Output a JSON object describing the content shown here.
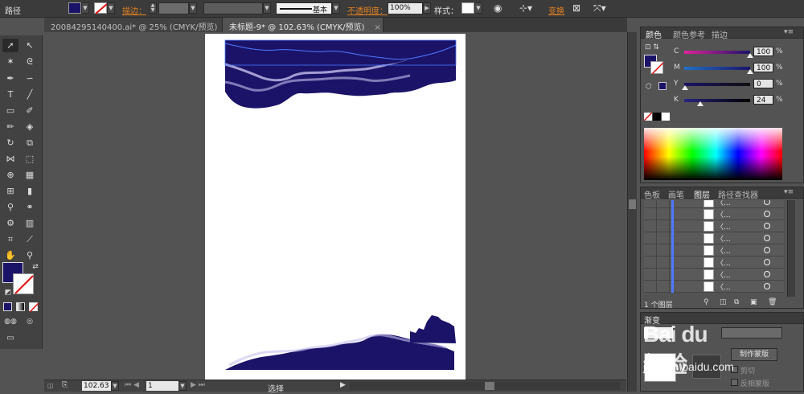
{
  "control_bar": {
    "path_label": "路径",
    "stroke_label": "描边：",
    "stroke_profile": "基本",
    "opacity_label": "不透明度：",
    "opacity_value": "100%",
    "style_label": "样式：",
    "transform_label": "变换",
    "fill_color": "#1b1368"
  },
  "tabs": [
    {
      "label": "20084295140400.ai* @ 25% (CMYK/预览)",
      "close": "×",
      "active": false
    },
    {
      "label": "未标题-9* @ 102.63% (CMYK/预览)",
      "close": "×",
      "active": true
    }
  ],
  "status_bar": {
    "zoom": "102.63",
    "page": "1",
    "selection": "选择"
  },
  "color_panel": {
    "tabs": [
      "颜色",
      "颜色参考",
      "描边"
    ],
    "channels": [
      {
        "label": "C",
        "value": "100"
      },
      {
        "label": "M",
        "value": "100"
      },
      {
        "label": "Y",
        "value": "0"
      },
      {
        "label": "K",
        "value": "24"
      }
    ],
    "fill_color": "#1b1368"
  },
  "layers_panel": {
    "tabs": [
      "色板",
      "画笔",
      "图层",
      "路径查找器"
    ],
    "rows": [
      "〈...",
      "〈...",
      "〈...",
      "〈...",
      "〈...",
      "〈...",
      "〈...",
      "〈..."
    ],
    "count_label": "1 个图层"
  },
  "gradient_panel": {
    "title": "渐变",
    "mask_button": "制作蒙版",
    "clip_label": "剪切",
    "invert_label": "反相蒙版"
  },
  "watermark": {
    "text": "Bai du 经验",
    "url": "jingyan.baidu.com"
  },
  "colors": {
    "artwork_dark": "#1b1368",
    "artwork_light": "#c6c0ee",
    "accent_orange": "#e2801f",
    "layer_blue": "#4d79ff"
  }
}
